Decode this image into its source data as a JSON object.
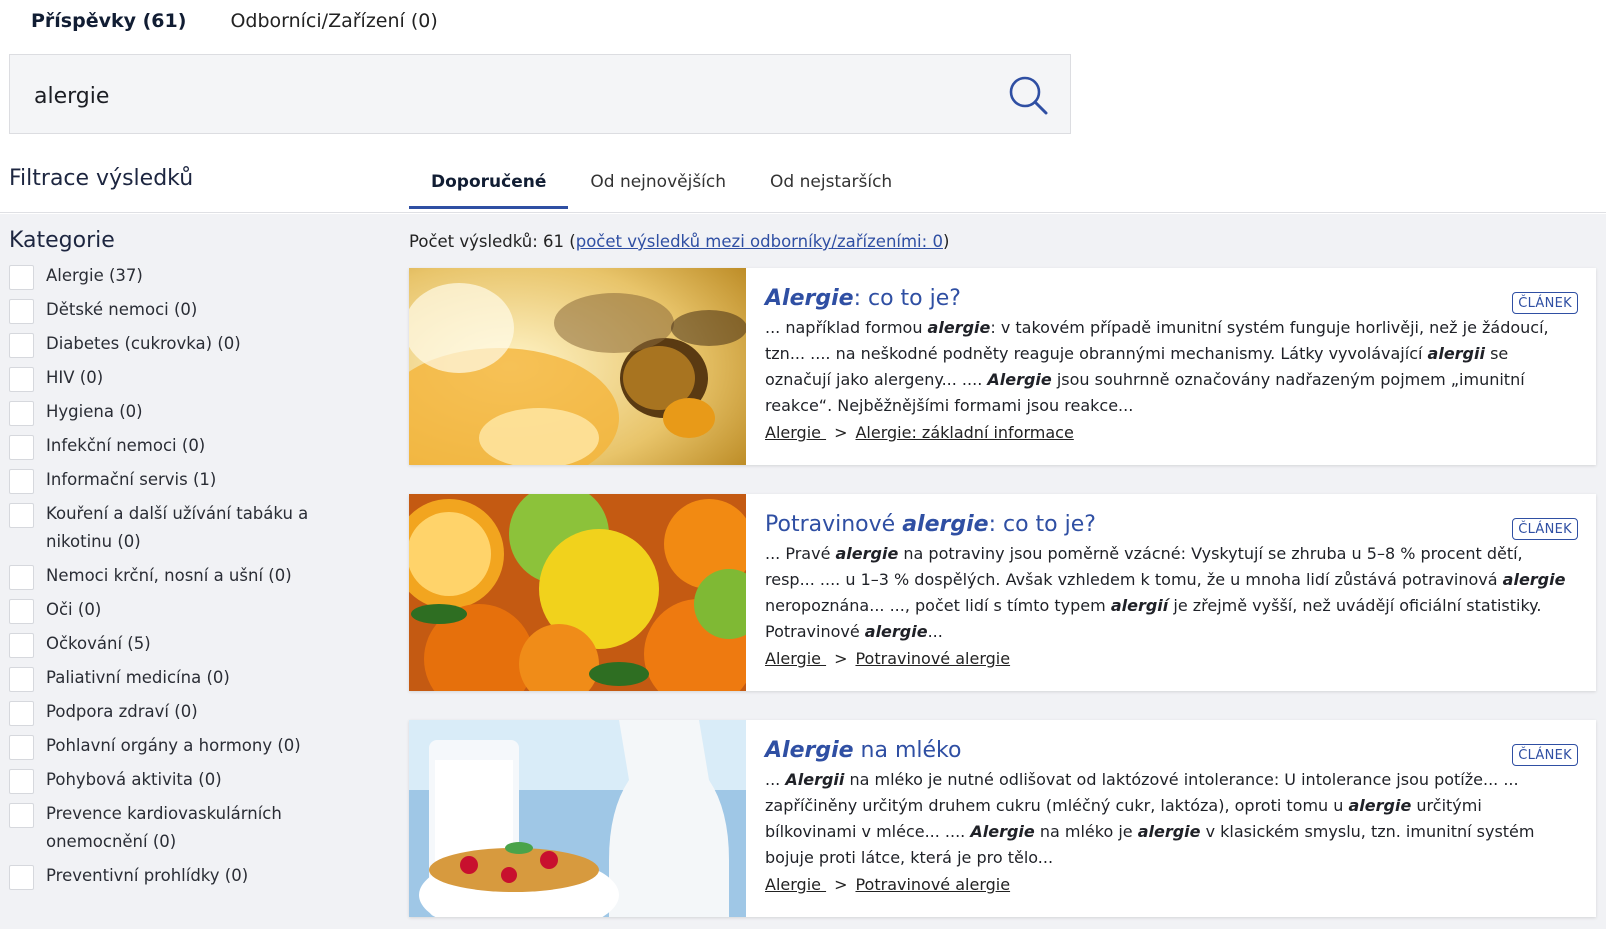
{
  "tabs": [
    {
      "label": "Příspěvky (61)",
      "active": true
    },
    {
      "label": "Odborníci/Zařízení (0)",
      "active": false
    }
  ],
  "search": {
    "value": "alergie",
    "button_icon": "search-icon"
  },
  "filter": {
    "title": "Filtrace výsledků",
    "category_title": "Kategorie"
  },
  "sort_tabs": [
    {
      "label": "Doporučené",
      "active": true
    },
    {
      "label": "Od nejnovějších",
      "active": false
    },
    {
      "label": "Od nejstarších",
      "active": false
    }
  ],
  "count": {
    "prefix": "Počet výsledků: 61 (",
    "link": "počet výsledků mezi odborníky/zařízeními: 0",
    "suffix": ")"
  },
  "categories": [
    "Alergie (37)",
    "Dětské nemoci (0)",
    "Diabetes (cukrovka) (0)",
    "HIV (0)",
    "Hygiena (0)",
    "Infekční nemoci (0)",
    "Informační servis (1)",
    "Kouření a další užívání tabáku a nikotinu (0)",
    "Nemoci krční, nosní a ušní (0)",
    "Oči (0)",
    "Očkování (5)",
    "Paliativní medicína (0)",
    "Podpora zdraví (0)",
    "Pohlavní orgány a hormony (0)",
    "Pohybová aktivita (0)",
    "Prevence kardiovaskulárních onemocnění (0)",
    "Preventivní prohlídky (0)"
  ],
  "results": [
    {
      "title_parts": [
        {
          "t": "Alergie",
          "em": true
        },
        {
          "t": ": co to je?",
          "em": false
        }
      ],
      "badge": "ČLÁNEK",
      "image": "bee-on-orange",
      "snippet": [
        {
          "t": "... například formou ",
          "b": false
        },
        {
          "t": "alergie",
          "b": true
        },
        {
          "t": ": v takovém případě imunitní systém funguje horlivěji, než je žádoucí, tzn... .... na neškodné podněty reaguje obrannými mechanismy. Látky vyvolávající ",
          "b": false
        },
        {
          "t": "alergii",
          "b": true
        },
        {
          "t": " se označují jako alergeny... .... ",
          "b": false
        },
        {
          "t": "Alergie",
          "b": true
        },
        {
          "t": " jsou souhrnně označovány nadřazeným pojmem „imunitní reakce“. Nejběžnějšími formami jsou reakce...",
          "b": false
        }
      ],
      "breadcrumbs": [
        "Alergie ",
        "Alergie: základní informace"
      ]
    },
    {
      "title_parts": [
        {
          "t": "Potravinové ",
          "em": false
        },
        {
          "t": "alergie",
          "em": true
        },
        {
          "t": ": co to je?",
          "em": false
        }
      ],
      "badge": "ČLÁNEK",
      "image": "citrus-fruits",
      "snippet": [
        {
          "t": "... Pravé ",
          "b": false
        },
        {
          "t": "alergie",
          "b": true
        },
        {
          "t": " na potraviny jsou poměrně vzácné: Vyskytují se zhruba u 5–8 % procent dětí, resp... .... u 1–3 % dospělých. Avšak vzhledem k tomu, že u mnoha lidí zůstává potravinová ",
          "b": false
        },
        {
          "t": "alergie",
          "b": true
        },
        {
          "t": " neropoznána... ..., počet lidí s tímto typem ",
          "b": false
        },
        {
          "t": "alergií",
          "b": true
        },
        {
          "t": " je zřejmě vyšší, než uvádějí oficiální statistiky. Potravinové ",
          "b": false
        },
        {
          "t": "alergie",
          "b": true
        },
        {
          "t": "...",
          "b": false
        }
      ],
      "breadcrumbs": [
        "Alergie ",
        "Potravinové alergie"
      ]
    },
    {
      "title_parts": [
        {
          "t": "Alergie",
          "em": true
        },
        {
          "t": " na mléko",
          "em": false
        }
      ],
      "badge": "ČLÁNEK",
      "image": "milk-and-cereal",
      "snippet": [
        {
          "t": "... ",
          "b": false
        },
        {
          "t": "Alergii",
          "b": true
        },
        {
          "t": " na mléko je nutné odlišovat od laktózové intolerance: U intolerance jsou potíže... ... zapříčiněny určitým druhem cukru (mléčný cukr, laktóza), oproti tomu u ",
          "b": false
        },
        {
          "t": "alergie",
          "b": true
        },
        {
          "t": " určitými bílkovinami v mléce... .... ",
          "b": false
        },
        {
          "t": "Alergie",
          "b": true
        },
        {
          "t": " na mléko je ",
          "b": false
        },
        {
          "t": "alergie",
          "b": true
        },
        {
          "t": " v klasickém smyslu, tzn. imunitní systém bojuje proti látce, která je pro tělo...",
          "b": false
        }
      ],
      "breadcrumbs": [
        "Alergie ",
        "Potravinové alergie"
      ]
    }
  ],
  "colors": {
    "accent": "#2f4fa3",
    "background": "#f1f2f5"
  }
}
